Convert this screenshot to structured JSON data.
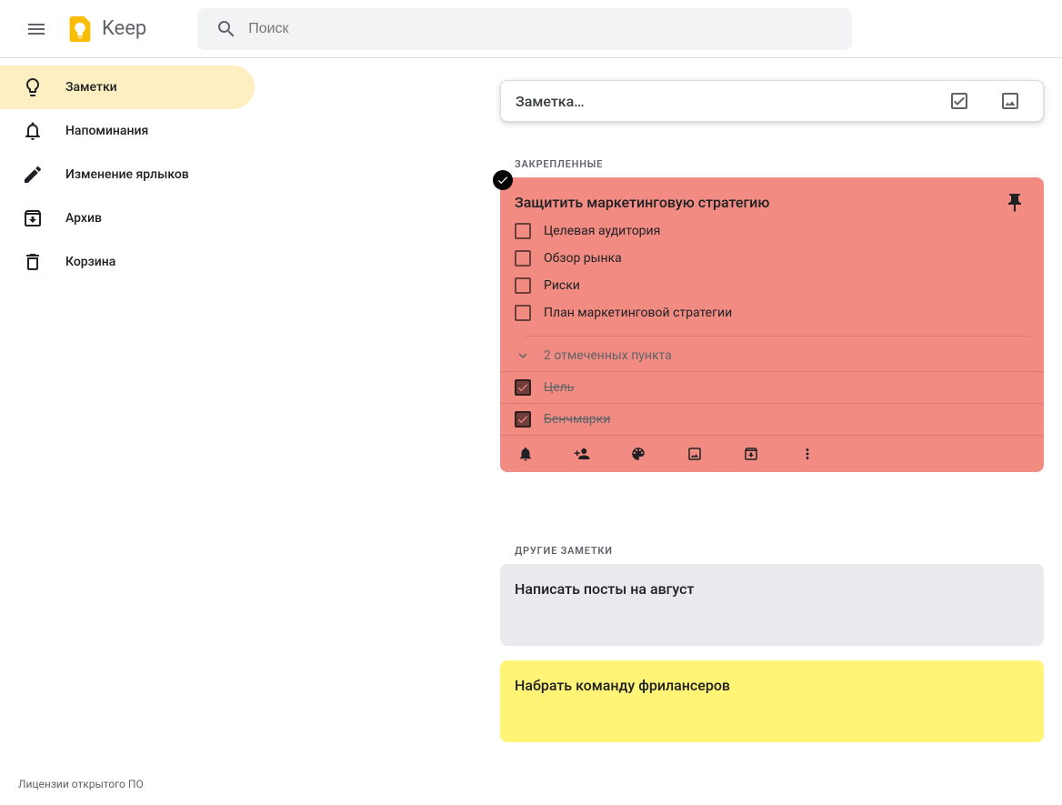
{
  "header": {
    "app_name": "Keep",
    "search_placeholder": "Поиск"
  },
  "sidebar": {
    "items": [
      {
        "label": "Заметки"
      },
      {
        "label": "Напоминания"
      },
      {
        "label": "Изменение ярлыков"
      },
      {
        "label": "Архив"
      },
      {
        "label": "Корзина"
      }
    ]
  },
  "new_note": {
    "placeholder": "Заметка…"
  },
  "sections": {
    "pinned": "Закрепленные",
    "others": "Другие заметки"
  },
  "pinned_note": {
    "title": "Защитить маркетинговую стратегию",
    "unchecked": [
      "Целевая аудитория",
      "Обзор рынка",
      "Риски",
      "План маркетинговой стратегии"
    ],
    "completed_label": "2 отмеченных пункта",
    "completed": [
      "Цель",
      "Бенчмарки"
    ]
  },
  "other_notes": [
    {
      "title": "Написать посты на август",
      "color": "beige"
    },
    {
      "title": "Набрать команду фрилансеров",
      "color": "yellow"
    }
  ],
  "footer": {
    "licenses": "Лицензии открытого ПО"
  }
}
